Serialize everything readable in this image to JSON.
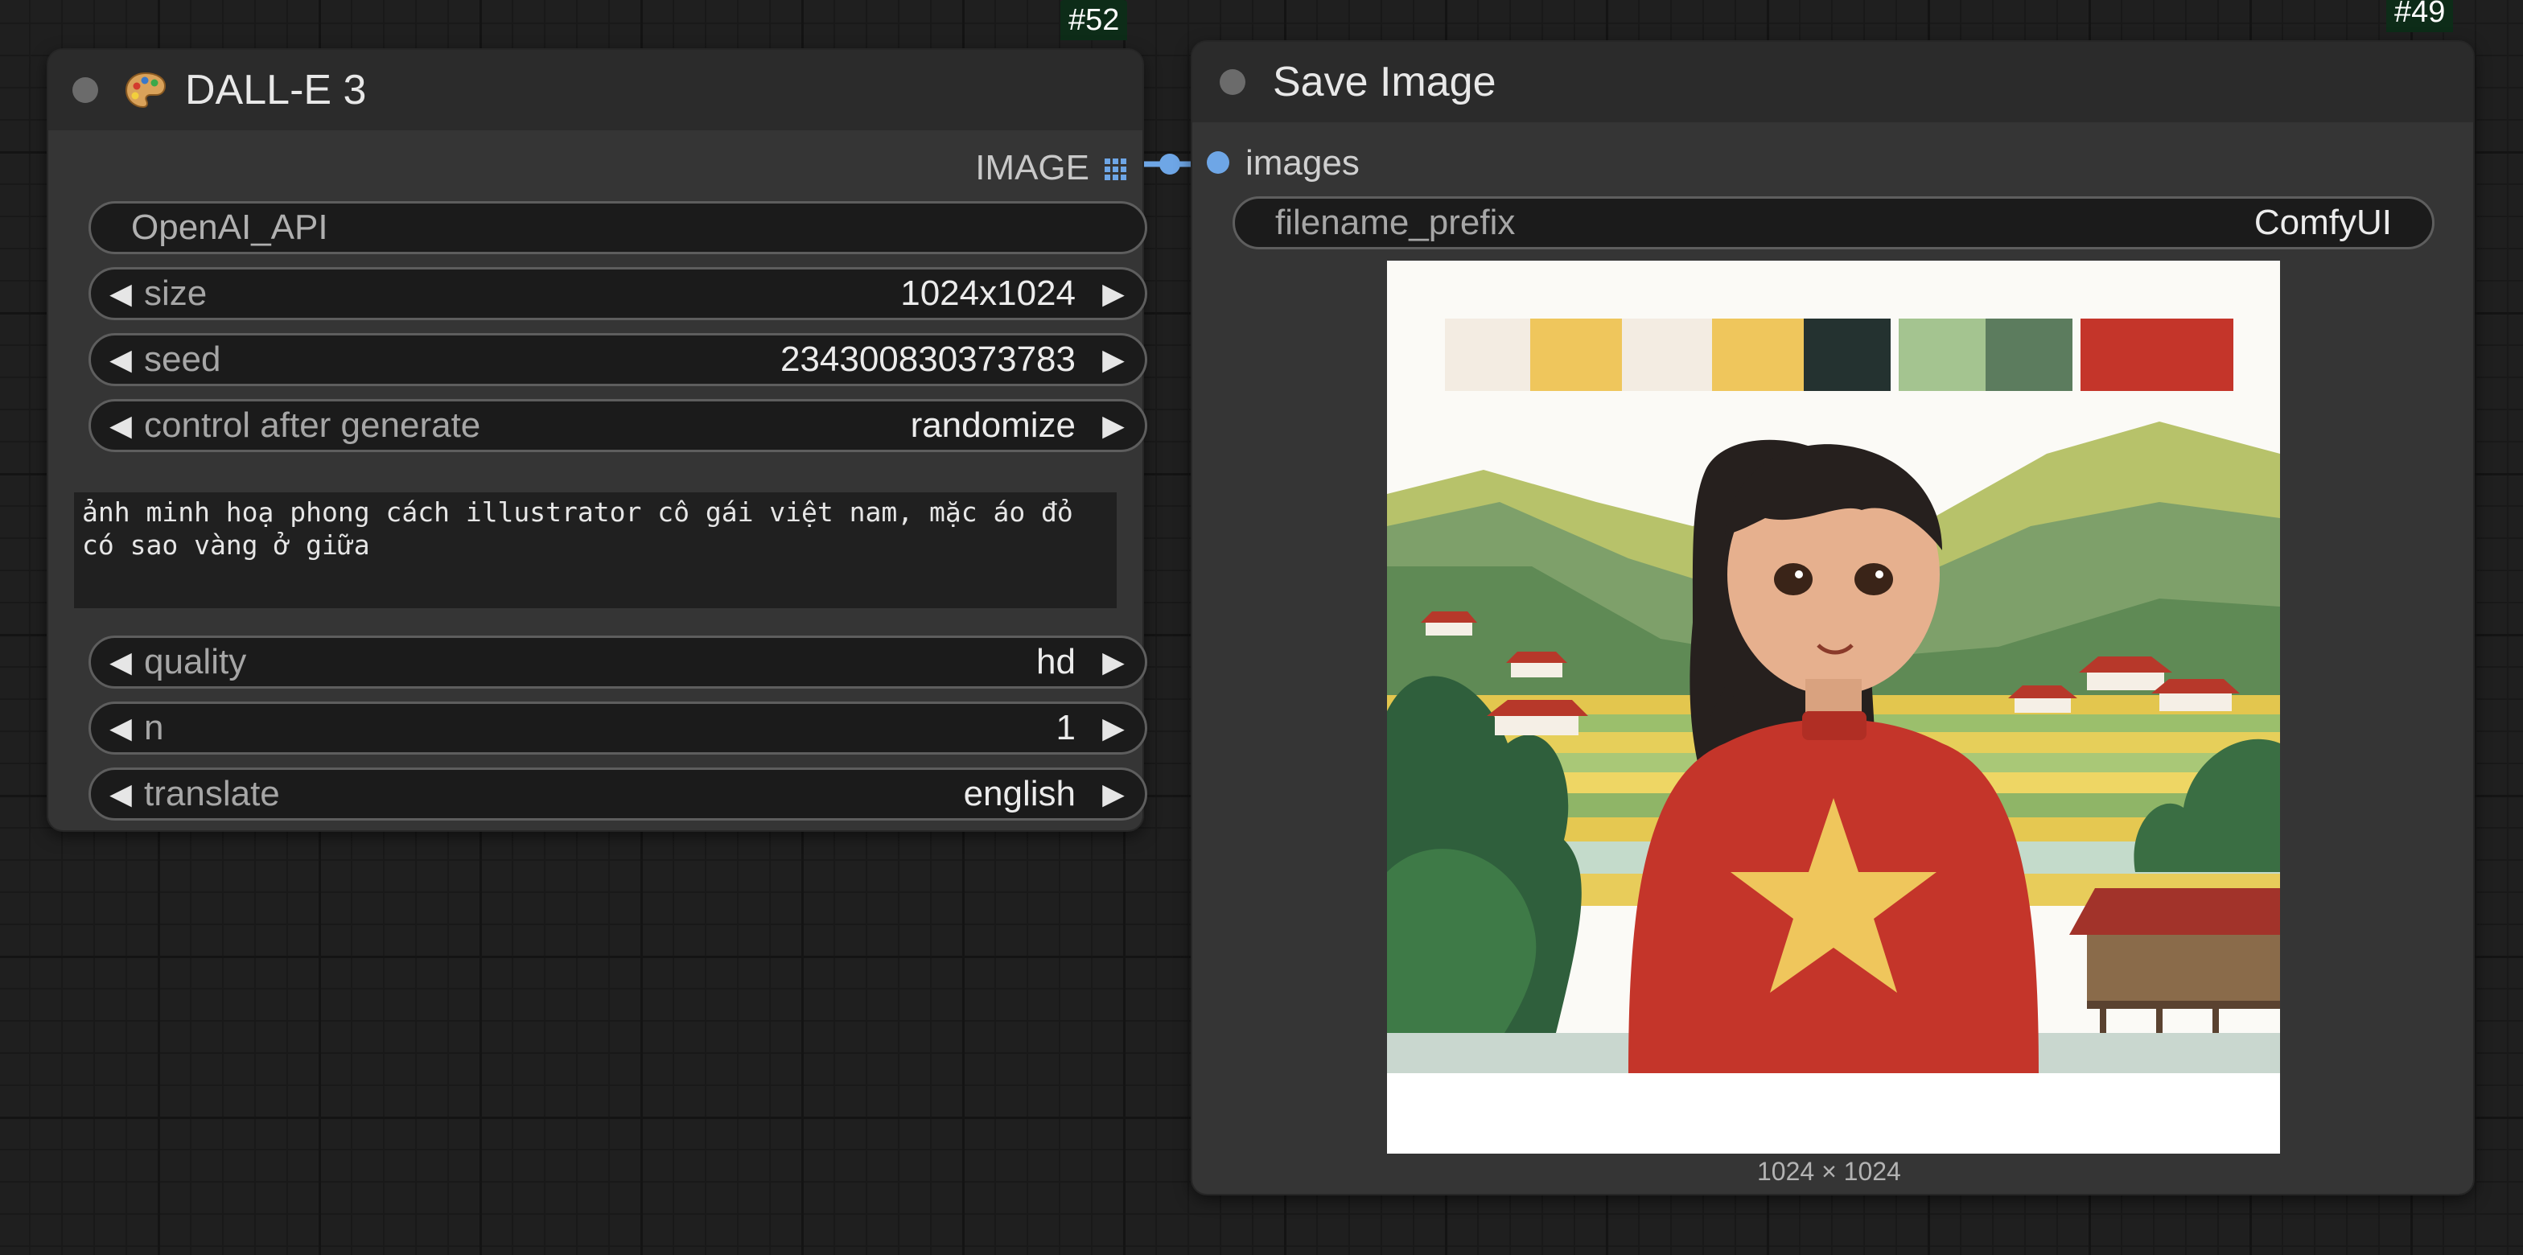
{
  "nodes": {
    "dalle": {
      "id_badge": "#52",
      "title": "DALL-E 3",
      "icon": "palette-icon",
      "output_label": "IMAGE",
      "api_field": "OpenAI_API",
      "widgets": [
        {
          "label": "size",
          "value": "1024x1024"
        },
        {
          "label": "seed",
          "value": "234300830373783"
        },
        {
          "label": "control after generate",
          "value": "randomize"
        }
      ],
      "prompt_text": "ảnh minh hoạ phong cách illustrator cô gái việt nam, mặc áo đỏ có sao vàng ở giữa",
      "widgets2": [
        {
          "label": "quality",
          "value": "hd"
        },
        {
          "label": "n",
          "value": "1"
        },
        {
          "label": "translate",
          "value": "english"
        }
      ]
    },
    "save": {
      "id_badge": "#49",
      "title": "Save Image",
      "input_label": "images",
      "prefix_label": "filename_prefix",
      "prefix_value": "ComfyUI",
      "preview_size": "1024 × 1024"
    }
  },
  "colors": {
    "link": "#6ea6e6",
    "node_bg": "#353535",
    "header_bg": "#2b2b2b",
    "badge_bg": "#0d2c18",
    "swatches": [
      "#f3ece2",
      "#efc65c",
      "#f3ece2",
      "#efc65c",
      "#243230",
      "#a4c490",
      "#5c7c5e",
      "#c4352a"
    ]
  }
}
